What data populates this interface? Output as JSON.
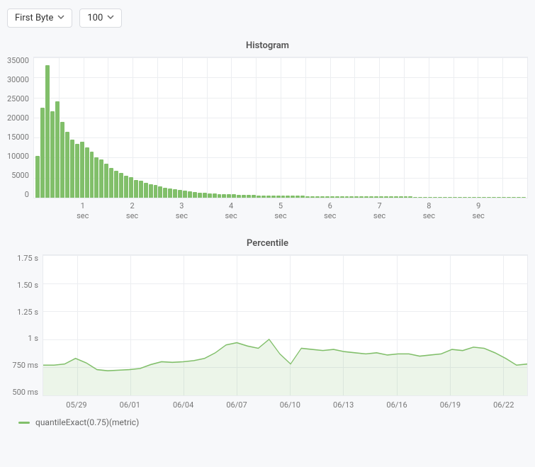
{
  "controls": {
    "metric_select": {
      "label": "First Byte"
    },
    "bins_select": {
      "label": "100"
    }
  },
  "colors": {
    "series_green": "#81bf6a"
  },
  "chart_data": [
    {
      "id": "histogram",
      "type": "bar",
      "title": "Histogram",
      "xlabel": "",
      "ylabel": "",
      "ylim": [
        0,
        35000
      ],
      "x_unit": "sec",
      "x_major_ticks": [
        1,
        2,
        3,
        4,
        5,
        6,
        7,
        8,
        9
      ],
      "y_ticks": [
        35000,
        30000,
        25000,
        20000,
        15000,
        10000,
        5000,
        0
      ],
      "values": [
        10500,
        22500,
        33000,
        21500,
        24000,
        19000,
        16500,
        14500,
        13500,
        14000,
        12500,
        11500,
        10000,
        9500,
        8500,
        7500,
        6800,
        6200,
        5500,
        5100,
        4500,
        4200,
        3800,
        3400,
        3100,
        2800,
        2500,
        2300,
        2100,
        1900,
        1700,
        1550,
        1400,
        1300,
        1200,
        1100,
        1000,
        950,
        900,
        850,
        800,
        750,
        700,
        680,
        650,
        620,
        600,
        580,
        560,
        540,
        520,
        500,
        480,
        470,
        450,
        440,
        420,
        410,
        400,
        390,
        380,
        370,
        360,
        350,
        340,
        330,
        320,
        315,
        310,
        305,
        300,
        295,
        290,
        285,
        280,
        275,
        270,
        265,
        260,
        255,
        250,
        245,
        240,
        235,
        230,
        225,
        220,
        215,
        210,
        205,
        200,
        195,
        190,
        185,
        180,
        175,
        170,
        165,
        160,
        155
      ]
    },
    {
      "id": "percentile",
      "type": "area",
      "title": "Percentile",
      "xlabel": "",
      "ylabel": "",
      "ylim": [
        500,
        1750
      ],
      "y_unit": "ms",
      "y_ticks": [
        {
          "v": 1750,
          "label": "1.75 s"
        },
        {
          "v": 1500,
          "label": "1.50 s"
        },
        {
          "v": 1250,
          "label": "1.25 s"
        },
        {
          "v": 1000,
          "label": "1 s"
        },
        {
          "v": 750,
          "label": "750 ms"
        },
        {
          "v": 500,
          "label": "500 ms"
        }
      ],
      "x_labels": [
        "05/29",
        "06/01",
        "06/04",
        "06/07",
        "06/10",
        "06/13",
        "06/16",
        "06/19",
        "06/22"
      ],
      "x_label_positions_pct": [
        7,
        18,
        29,
        40,
        51,
        62,
        73,
        84,
        95
      ],
      "series": [
        {
          "name": "quantileExact(0.75)(metric)",
          "values": [
            770,
            770,
            780,
            830,
            790,
            730,
            720,
            725,
            730,
            740,
            775,
            800,
            795,
            800,
            810,
            830,
            880,
            950,
            970,
            940,
            920,
            1000,
            870,
            780,
            920,
            910,
            900,
            910,
            890,
            880,
            870,
            880,
            860,
            870,
            870,
            850,
            860,
            870,
            910,
            900,
            930,
            920,
            880,
            830,
            770,
            780
          ]
        }
      ]
    }
  ],
  "legend": {
    "percentile": "quantileExact(0.75)(metric)"
  }
}
